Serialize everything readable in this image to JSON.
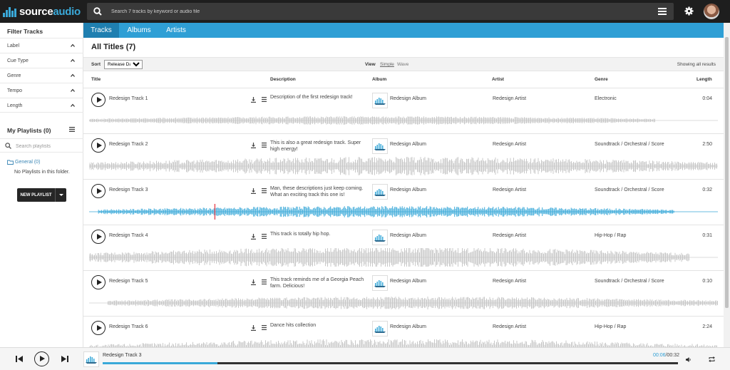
{
  "brand": {
    "name_prefix": "source",
    "name_suffix": "audio",
    "accent": "#3aa9d9"
  },
  "search": {
    "placeholder": "Search 7 tracks by keyword or audio file"
  },
  "sidebar": {
    "filter_title": "Filter Tracks",
    "filters": [
      "Label",
      "Cue Type",
      "Genre",
      "Tempo",
      "Length"
    ],
    "playlists_title": "My Playlists (0)",
    "playlist_search_placeholder": "Search playlists",
    "folder": "General (0)",
    "empty_text": "No Playlists in this folder.",
    "new_playlist": "NEW PLAYLIST"
  },
  "tabs": [
    "Tracks",
    "Albums",
    "Artists"
  ],
  "main": {
    "title": "All Titles (7)",
    "sort_label": "Sort",
    "sort_value": "Release Date",
    "view_label": "View",
    "view_simple": "Simple",
    "view_wave": "Wave",
    "showing": "Showing all results"
  },
  "columns": {
    "title": "Title",
    "description": "Description",
    "album": "Album",
    "artist": "Artist",
    "genre": "Genre",
    "length": "Length"
  },
  "tracks": [
    {
      "title": "Redesign Track 1",
      "description": "Description of the first redesign track!",
      "album": "Redesign Album",
      "artist": "Redesign Artist",
      "genre": "Electronic",
      "length": "0:04"
    },
    {
      "title": "Redesign Track 2",
      "description": "This is also a great redesign track. Super high energy!",
      "album": "Redesign Album",
      "artist": "Redesign Artist",
      "genre": "Soundtrack / Orchestral / Score",
      "length": "2:50"
    },
    {
      "title": "Redesign Track 3",
      "description": "Man, these descriptions just keep coming. What an exciting track this one is!",
      "album": "Redesign Album",
      "artist": "Redesign Artist",
      "genre": "Soundtrack / Orchestral / Score",
      "length": "0:32"
    },
    {
      "title": "Redesign Track 4",
      "description": "This track is totally hip hop.",
      "album": "Redesign Album",
      "artist": "Redesign Artist",
      "genre": "Hip-Hop / Rap",
      "length": "0:31"
    },
    {
      "title": "Redesign Track 5",
      "description": "This track reminds me of a Georgia Peach farm. Delicious!",
      "album": "Redesign Album",
      "artist": "Redesign Artist",
      "genre": "Soundtrack / Orchestral / Score",
      "length": "0:10"
    },
    {
      "title": "Redesign Track 6",
      "description": "Dance hits collection",
      "album": "Redesign Album",
      "artist": "Redesign Artist",
      "genre": "Hip-Hop / Rap",
      "length": "2:24"
    }
  ],
  "player": {
    "title": "Redesign Track 3",
    "current": "00:06",
    "total": "00:32",
    "progress": 0.2
  }
}
